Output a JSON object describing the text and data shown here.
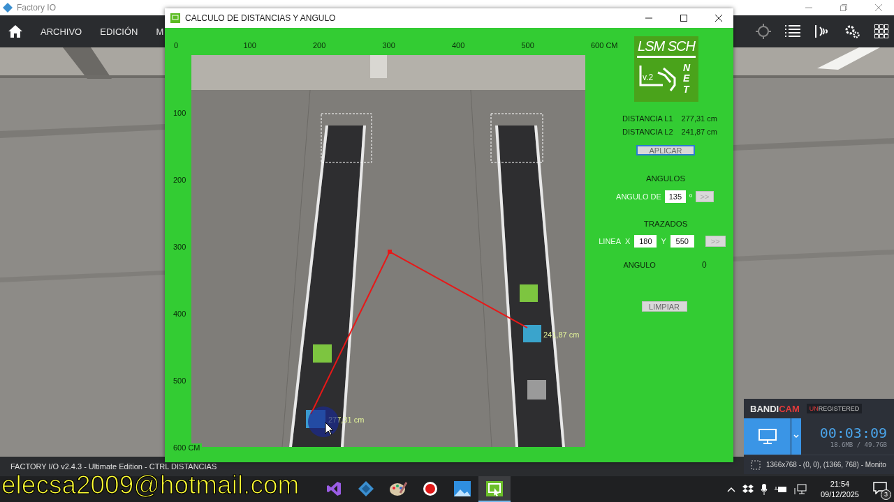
{
  "app_window": {
    "title": "Factory IO"
  },
  "toolbar": {
    "menus": [
      "ARCHIVO",
      "EDICIÓN",
      "M"
    ]
  },
  "status_bar": "FACTORY I/O v2.4.3 - Ultimate Edition - CTRL DISTANCIAS",
  "dialog": {
    "title": "CALCULO DE DISTANCIAS Y ANGULO",
    "top_ruler": [
      "0",
      "100",
      "200",
      "300",
      "400",
      "500",
      "600 CM"
    ],
    "left_ruler": [
      "100",
      "200",
      "300",
      "400",
      "500",
      "600 CM"
    ],
    "measurements": [
      {
        "label": "277,31 cm"
      },
      {
        "label": "241,87 cm"
      }
    ],
    "logo": {
      "title": "LSM SCH",
      "version": "v.2",
      "side": "NET"
    },
    "distances": [
      {
        "label": "DISTANCIA L1",
        "value": "277,31 cm"
      },
      {
        "label": "DISTANCIA L2",
        "value": "241,87 cm"
      }
    ],
    "apply_button": {
      "label": "APLICAR",
      "focused": true
    },
    "angles": {
      "heading": "ANGULOS",
      "label": "ANGULO DE",
      "value": "135",
      "unit": "º",
      "button": {
        "label": ">>",
        "disabled": true
      }
    },
    "traces": {
      "heading": "TRAZADOS",
      "label": "LINEA",
      "x_label": "X",
      "x_value": "180",
      "y_label": "Y",
      "y_value": "550",
      "button": {
        "label": ">>",
        "disabled": true
      }
    },
    "angle_result": {
      "label": "ANGULO",
      "value": "0"
    },
    "clear_button": {
      "label": "LIMPIAR"
    }
  },
  "recorder": {
    "brand": [
      "BANDI",
      "CAM"
    ],
    "badge": [
      "UN",
      "REGISTERED"
    ],
    "timer": "00:03:09",
    "size": "18.6MB / 49.7GB",
    "area": "1366x768 - (0, 0), (1366, 768) - Monito"
  },
  "taskbar": {
    "apps": [
      {
        "kind": "studio",
        "selected": false
      },
      {
        "kind": "diamond",
        "selected": false
      },
      {
        "kind": "palette",
        "selected": false
      },
      {
        "kind": "record",
        "selected": false
      },
      {
        "kind": "photos",
        "selected": false
      },
      {
        "kind": "measure",
        "selected": true
      }
    ],
    "time": "21:54",
    "date": "09/12/2025",
    "notifications": "3"
  },
  "overlay_caption": "elecsa2009@hotmail.com"
}
